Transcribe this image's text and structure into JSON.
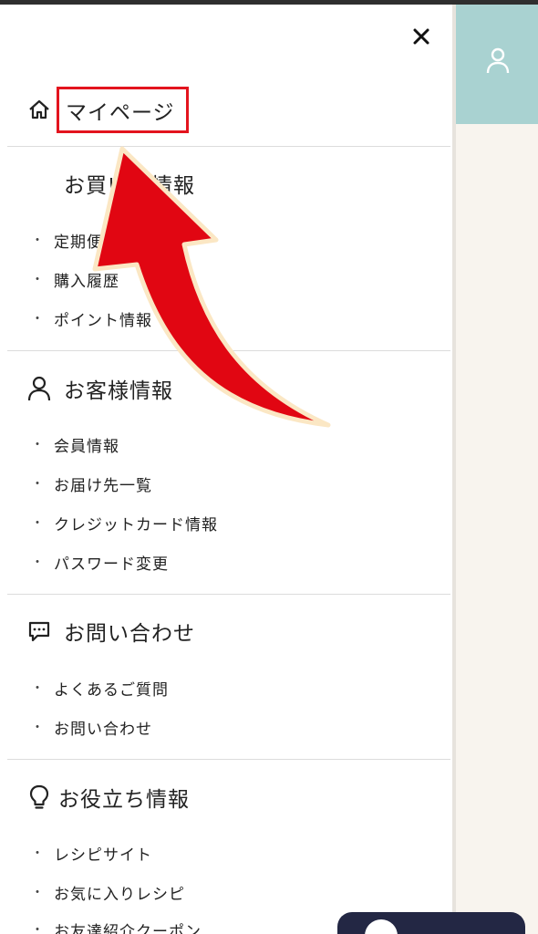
{
  "drawer": {
    "mypage": {
      "label": "マイページ",
      "icon": "home-icon"
    },
    "sections": [
      {
        "title": "お買い物情報",
        "icon": "cart-icon",
        "items": [
          "定期便",
          "購入履歴",
          "ポイント情報"
        ]
      },
      {
        "title": "お客様情報",
        "icon": "person-icon",
        "items": [
          "会員情報",
          "お届け先一覧",
          "クレジットカード情報",
          "パスワード変更"
        ]
      },
      {
        "title": "お問い合わせ",
        "icon": "chat-bubble-icon",
        "items": [
          "よくあるご質問",
          "お問い合わせ"
        ]
      },
      {
        "title": "お役立ち情報",
        "icon": "lightbulb-icon",
        "items": [
          "レシピサイト",
          "お気に入りレシピ",
          "お友達紹介クーポン"
        ]
      }
    ],
    "bullet": "・",
    "close_icon": "close-icon"
  },
  "colors": {
    "highlight_box": "#e3141e",
    "annotation_arrow": "#e10612",
    "header_bg": "#a9d2d1",
    "bottom_button": "#232744"
  }
}
